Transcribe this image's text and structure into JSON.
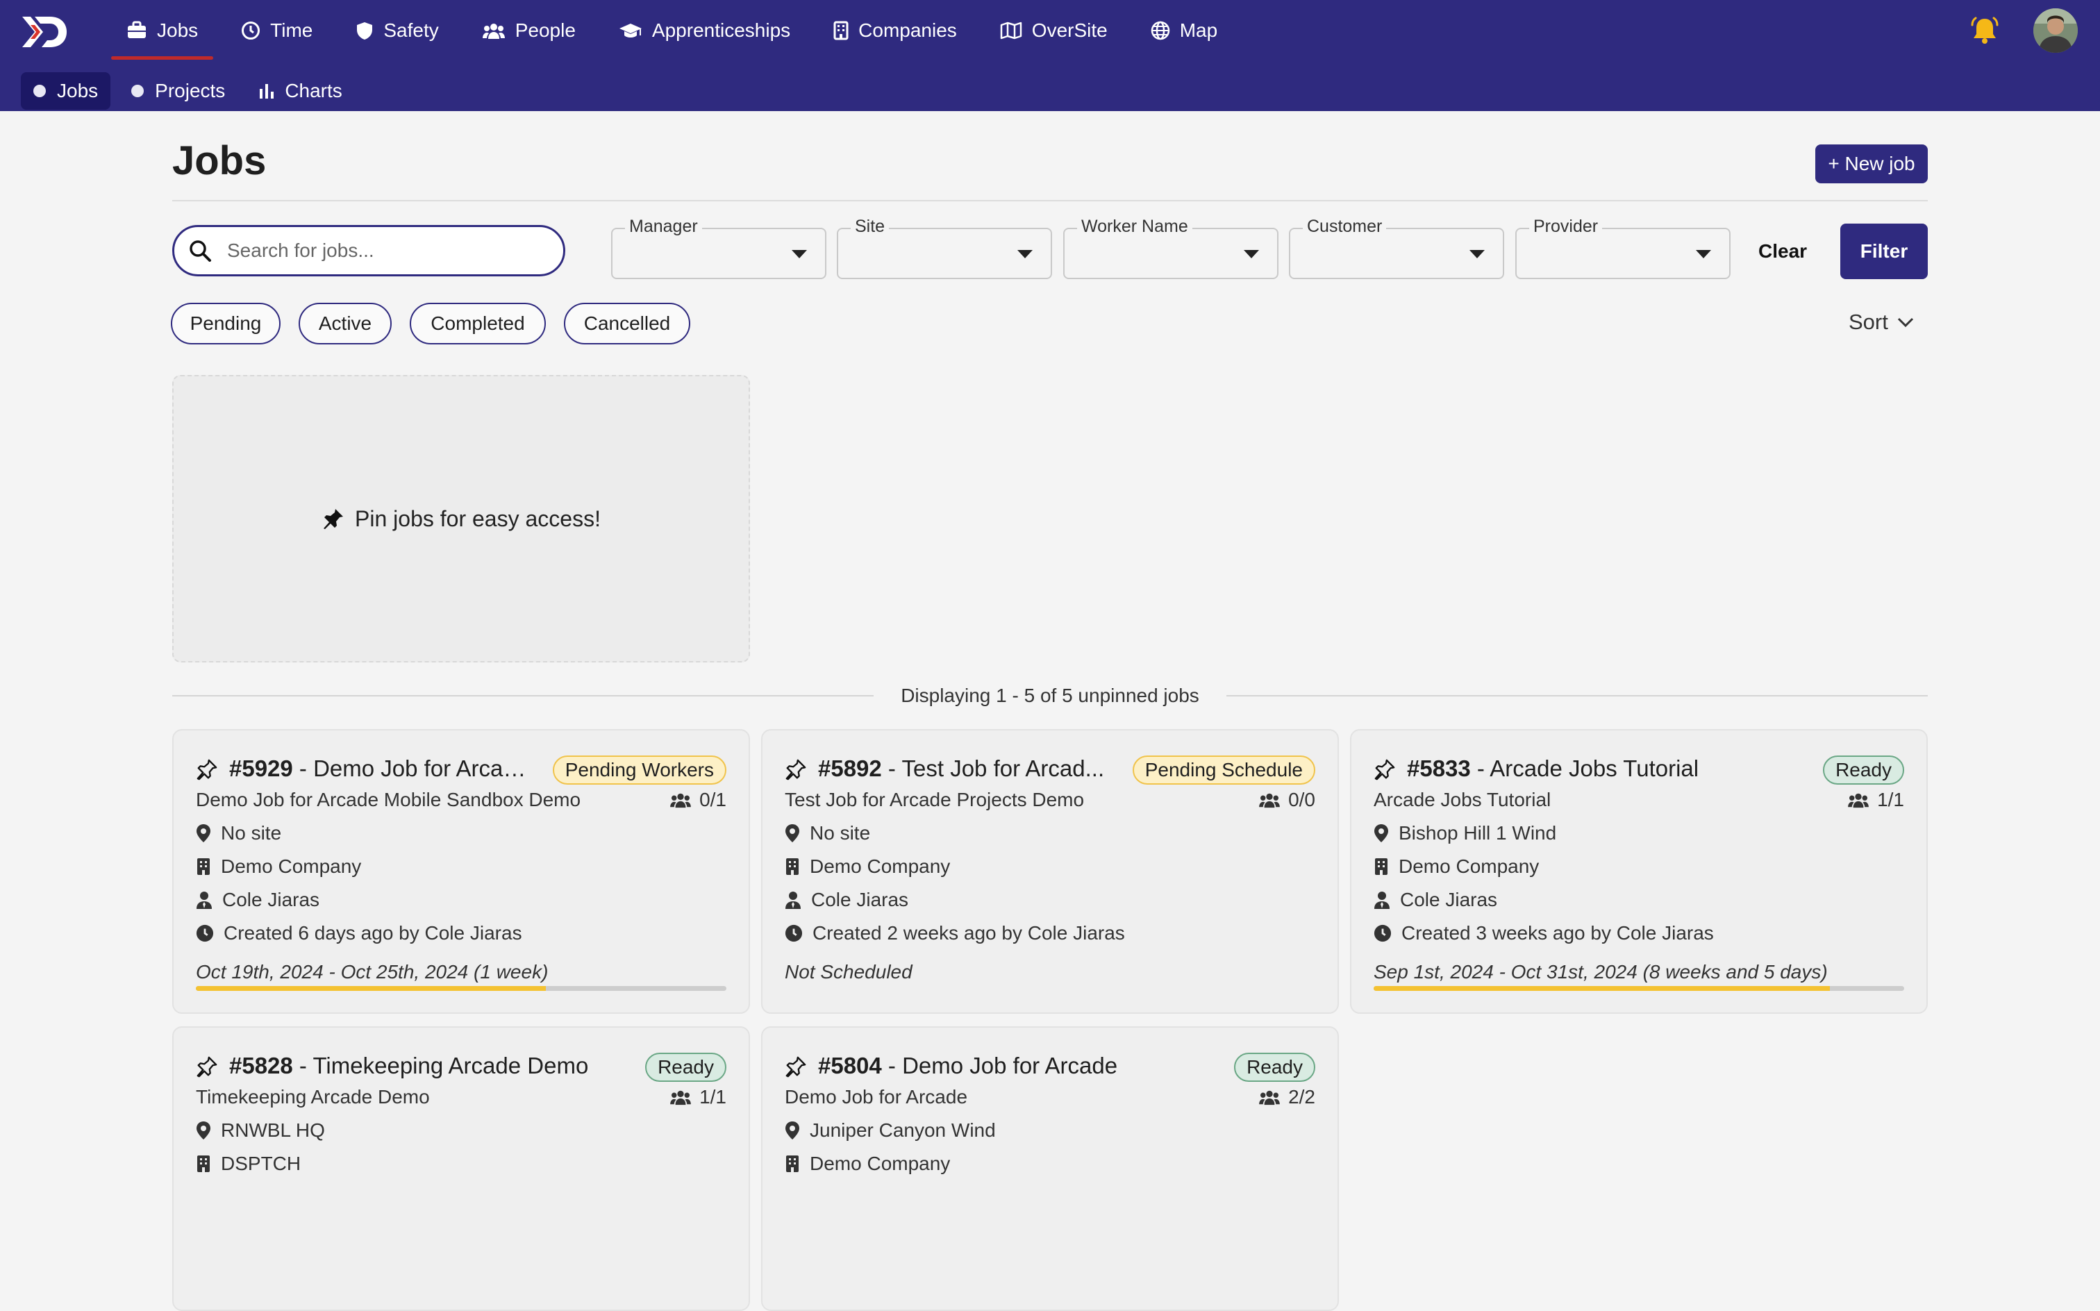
{
  "nav": {
    "main": [
      {
        "label": "Jobs",
        "icon": "briefcase-icon"
      },
      {
        "label": "Time",
        "icon": "clock-icon"
      },
      {
        "label": "Safety",
        "icon": "shield-icon"
      },
      {
        "label": "People",
        "icon": "people-icon"
      },
      {
        "label": "Apprenticeships",
        "icon": "graduation-cap-icon"
      },
      {
        "label": "Companies",
        "icon": "building-icon"
      },
      {
        "label": "OverSite",
        "icon": "map-fold-icon"
      },
      {
        "label": "Map",
        "icon": "globe-icon"
      }
    ],
    "sub": [
      {
        "label": "Jobs",
        "icon": "dot-icon"
      },
      {
        "label": "Projects",
        "icon": "dot-icon"
      },
      {
        "label": "Charts",
        "icon": "bar-chart-icon"
      }
    ]
  },
  "header": {
    "title": "Jobs",
    "new_job_label": "+ New job"
  },
  "filters": {
    "search_placeholder": "Search for jobs...",
    "dropdowns": [
      {
        "label": "Manager",
        "value": ""
      },
      {
        "label": "Site",
        "value": ""
      },
      {
        "label": "Worker Name",
        "value": ""
      },
      {
        "label": "Customer",
        "value": ""
      },
      {
        "label": "Provider",
        "value": ""
      }
    ],
    "clear_label": "Clear",
    "filter_label": "Filter",
    "statuses": [
      "Pending",
      "Active",
      "Completed",
      "Cancelled"
    ],
    "sort_label": "Sort"
  },
  "pinned": {
    "empty_text": "Pin jobs for easy access!"
  },
  "list": {
    "summary": "Displaying 1 - 5 of 5 unpinned jobs"
  },
  "jobs": [
    {
      "number": "#5929",
      "title": "Demo Job for Arcad...",
      "status": "Pending Workers",
      "status_color": "yellow",
      "subtitle": "Demo Job for Arcade Mobile Sandbox Demo",
      "workers": "0/1",
      "site": "No site",
      "company": "Demo Company",
      "person": "Cole Jiaras",
      "created": "Created 6 days ago by Cole Jiaras",
      "dates": "Oct 19th, 2024 - Oct 25th, 2024 (1 week)",
      "progress": 0.66
    },
    {
      "number": "#5892",
      "title": "Test Job for Arcad...",
      "status": "Pending Schedule",
      "status_color": "yellow",
      "subtitle": "Test Job for Arcade Projects Demo",
      "workers": "0/0",
      "site": "No site",
      "company": "Demo Company",
      "person": "Cole Jiaras",
      "created": "Created 2 weeks ago by Cole Jiaras",
      "dates": "Not Scheduled",
      "progress": null
    },
    {
      "number": "#5833",
      "title": "Arcade Jobs Tutorial",
      "status": "Ready",
      "status_color": "green",
      "subtitle": "Arcade Jobs Tutorial",
      "workers": "1/1",
      "site": "Bishop Hill 1 Wind",
      "company": "Demo Company",
      "person": "Cole Jiaras",
      "created": "Created 3 weeks ago by Cole Jiaras",
      "dates": "Sep 1st, 2024 - Oct 31st, 2024 (8 weeks and 5 days)",
      "progress": 0.86
    },
    {
      "number": "#5828",
      "title": "Timekeeping Arcade Demo",
      "status": "Ready",
      "status_color": "green",
      "subtitle": "Timekeeping Arcade Demo",
      "workers": "1/1",
      "site": "RNWBL HQ",
      "company": "DSPTCH"
    },
    {
      "number": "#5804",
      "title": "Demo Job for Arcade",
      "status": "Ready",
      "status_color": "green",
      "subtitle": "Demo Job for Arcade",
      "workers": "2/2",
      "site": "Juniper Canyon Wind",
      "company": "Demo Company"
    }
  ],
  "colors": {
    "brand": "#2f2a7f",
    "nav_active_underline": "#c02a2a",
    "badge_yellow": "#fdf0c6",
    "badge_green": "#d9ebe2",
    "progress": "#f4c232"
  }
}
